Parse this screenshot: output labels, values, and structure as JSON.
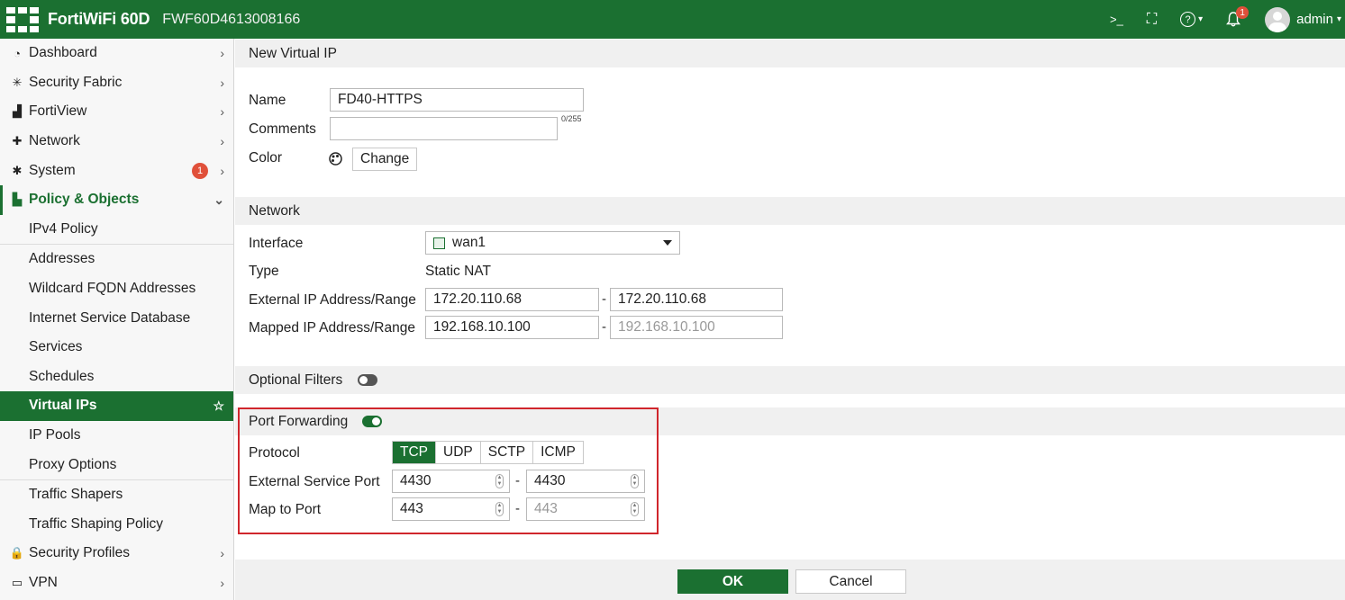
{
  "header": {
    "brand": "FortiWiFi 60D",
    "serial": "FWF60D4613008166",
    "terminal_icon": ">_",
    "fullscreen_icon": "⛶",
    "help_icon": "?",
    "help_caret": "▾",
    "bell_icon": "🔔",
    "bell_count": "1",
    "user": "admin",
    "user_caret": "▾"
  },
  "sidebar": {
    "items": [
      {
        "label": "Dashboard",
        "icon": "dashboard-icon",
        "glyph": "◔",
        "chev": "›"
      },
      {
        "label": "Security Fabric",
        "icon": "fabric-icon",
        "glyph": "✳",
        "chev": "›"
      },
      {
        "label": "FortiView",
        "icon": "chart-icon",
        "glyph": "▟",
        "chev": "›"
      },
      {
        "label": "Network",
        "icon": "network-icon",
        "glyph": "✚",
        "chev": "›"
      },
      {
        "label": "System",
        "icon": "gear-icon",
        "glyph": "✱",
        "chev": "›",
        "badge": "1"
      },
      {
        "label": "Policy & Objects",
        "icon": "policy-icon",
        "glyph": "▙",
        "chev": "⌄"
      }
    ],
    "sub_items": [
      "IPv4 Policy",
      "Addresses",
      "Wildcard FQDN Addresses",
      "Internet Service Database",
      "Services",
      "Schedules",
      "Virtual IPs",
      "IP Pools",
      "Proxy Options",
      "Traffic Shapers",
      "Traffic Shaping Policy"
    ],
    "star": "☆",
    "bottom_items": [
      {
        "label": "Security Profiles",
        "icon": "lock-icon",
        "glyph": "🔒",
        "chev": "›"
      },
      {
        "label": "VPN",
        "icon": "monitor-icon",
        "glyph": "▭",
        "chev": "›"
      }
    ]
  },
  "form": {
    "title": "New Virtual IP",
    "name_label": "Name",
    "name_value": "FD40-HTTPS",
    "comments_label": "Comments",
    "comments_value": "",
    "comments_counter": "0/255",
    "color_label": "Color",
    "color_icon": "palette-icon",
    "change_button": "Change",
    "network_heading": "Network",
    "interface_label": "Interface",
    "interface_value": "wan1",
    "type_label": "Type",
    "type_value": "Static NAT",
    "ext_ip_label": "External IP Address/Range",
    "ext_ip_start": "172.20.110.68",
    "ext_ip_end": "172.20.110.68",
    "mapped_ip_label": "Mapped IP Address/Range",
    "mapped_ip_start": "192.168.10.100",
    "mapped_ip_end": "192.168.10.100",
    "range_dash": "-",
    "optional_filters_label": "Optional Filters",
    "port_forwarding_label": "Port Forwarding",
    "protocol_label": "Protocol",
    "protocols": [
      "TCP",
      "UDP",
      "SCTP",
      "ICMP"
    ],
    "ext_port_label": "External Service Port",
    "ext_port_start": "4430",
    "ext_port_end": "4430",
    "map_port_label": "Map to Port",
    "map_port_start": "443",
    "map_port_end": "443",
    "ok_button": "OK",
    "cancel_button": "Cancel",
    "spin_up": "▲",
    "spin_down": "▼"
  },
  "colors": {
    "accent": "#1b7031",
    "highlight_box": "#d0262c",
    "badge": "#e0503a"
  }
}
